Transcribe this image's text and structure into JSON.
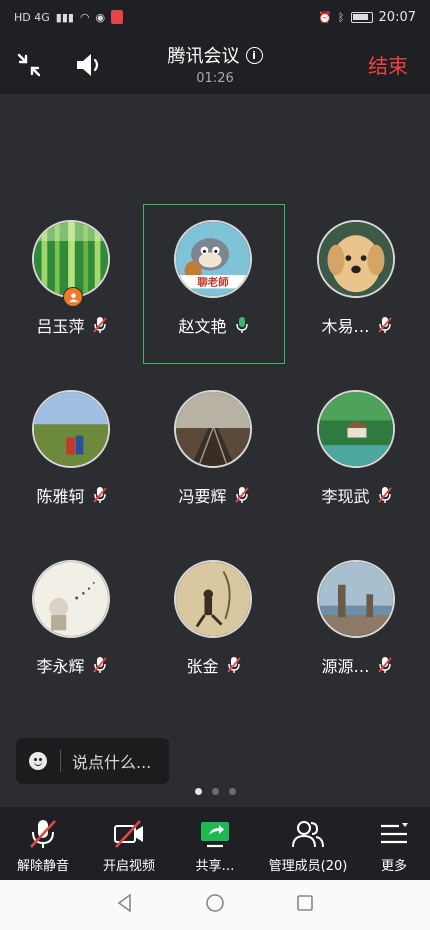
{
  "status_bar": {
    "left_text": "HD 4G",
    "time": "20:07"
  },
  "header": {
    "title": "腾讯会议",
    "timer": "01:26",
    "end_label": "结束"
  },
  "participants": [
    {
      "name": "吕玉萍",
      "mic": "muted",
      "host": true,
      "speaking": false
    },
    {
      "name": "赵文艳",
      "mic": "on",
      "host": false,
      "speaking": true
    },
    {
      "name": "木易…",
      "mic": "muted",
      "host": false,
      "speaking": false
    },
    {
      "name": "陈雅轲",
      "mic": "muted",
      "host": false,
      "speaking": false
    },
    {
      "name": "冯要辉",
      "mic": "muted",
      "host": false,
      "speaking": false
    },
    {
      "name": "李现武",
      "mic": "muted",
      "host": false,
      "speaking": false
    },
    {
      "name": "李永辉",
      "mic": "muted",
      "host": false,
      "speaking": false
    },
    {
      "name": "张金",
      "mic": "muted",
      "host": false,
      "speaking": false
    },
    {
      "name": "源源…",
      "mic": "muted",
      "host": false,
      "speaking": false
    }
  ],
  "chat": {
    "placeholder": "说点什么..."
  },
  "pager": {
    "pages": 3,
    "current": 1
  },
  "toolbar": {
    "unmute_label": "解除静音",
    "video_label": "开启视频",
    "share_label": "共享…",
    "members_label": "管理成员(20)",
    "more_label": "更多"
  },
  "colors": {
    "end": "#f04040",
    "active_border": "#3bb866",
    "mic_on": "#3bb866",
    "mic_muted": "#e54545",
    "share": "#1db954"
  }
}
